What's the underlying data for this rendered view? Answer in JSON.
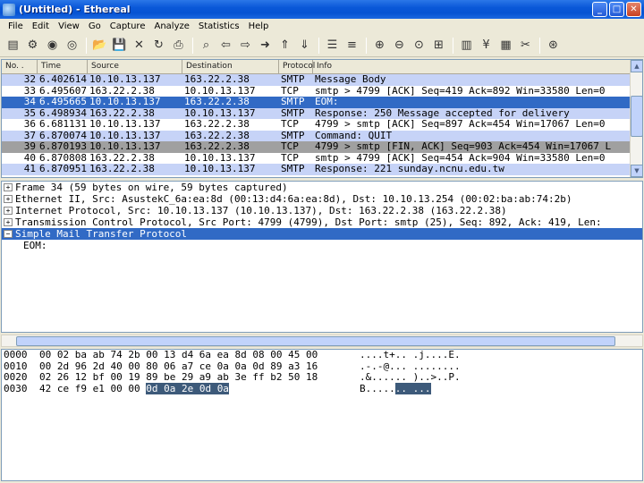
{
  "window": {
    "title": "(Untitled) - Ethereal",
    "minimize": "_",
    "maximize": "□",
    "close": "✕"
  },
  "menu": [
    "File",
    "Edit",
    "View",
    "Go",
    "Capture",
    "Analyze",
    "Statistics",
    "Help"
  ],
  "toolbar_icons": [
    "interface-list-icon",
    "capture-options-icon",
    "start-capture-icon",
    "restart-capture-icon",
    "|",
    "open-file-icon",
    "save-icon",
    "close-file-icon",
    "reload-icon",
    "print-icon",
    "|",
    "find-packet-icon",
    "go-back-icon",
    "go-forward-icon",
    "go-to-packet-icon",
    "go-first-icon",
    "go-last-icon",
    "|",
    "colorize-icon",
    "auto-scroll-icon",
    "|",
    "zoom-in-icon",
    "zoom-out-icon",
    "zoom-normal-icon",
    "resize-columns-icon",
    "|",
    "capture-filters-icon",
    "display-filters-icon",
    "coloring-rules-icon",
    "preferences-icon",
    "|",
    "help-icon"
  ],
  "packet_list": {
    "columns": [
      "No. .",
      "Time",
      "Source",
      "Destination",
      "Protocol",
      "Info"
    ],
    "rows": [
      {
        "no": "32",
        "time": "6.402614",
        "src": "10.10.13.137",
        "dst": "163.22.2.38",
        "proto": "SMTP",
        "info": "Message Body",
        "bg": "#c6d3f7",
        "fg": "#000000"
      },
      {
        "no": "33",
        "time": "6.495607",
        "src": "163.22.2.38",
        "dst": "10.10.13.137",
        "proto": "TCP",
        "info": "smtp > 4799 [ACK] Seq=419 Ack=892 Win=33580 Len=0",
        "bg": "#ffffff",
        "fg": "#000000"
      },
      {
        "no": "34",
        "time": "6.495665",
        "src": "10.10.13.137",
        "dst": "163.22.2.38",
        "proto": "SMTP",
        "info": "EOM:",
        "bg": "#316ac5",
        "fg": "#ffffff"
      },
      {
        "no": "35",
        "time": "6.498934",
        "src": "163.22.2.38",
        "dst": "10.10.13.137",
        "proto": "SMTP",
        "info": "Response: 250 Message accepted for delivery",
        "bg": "#c6d3f7",
        "fg": "#000000"
      },
      {
        "no": "36",
        "time": "6.681131",
        "src": "10.10.13.137",
        "dst": "163.22.2.38",
        "proto": "TCP",
        "info": "4799 > smtp [ACK] Seq=897 Ack=454 Win=17067 Len=0",
        "bg": "#ffffff",
        "fg": "#000000"
      },
      {
        "no": "37",
        "time": "6.870074",
        "src": "10.10.13.137",
        "dst": "163.22.2.38",
        "proto": "SMTP",
        "info": "Command: QUIT",
        "bg": "#c6d3f7",
        "fg": "#000000"
      },
      {
        "no": "39",
        "time": "6.870193",
        "src": "10.10.13.137",
        "dst": "163.22.2.38",
        "proto": "TCP",
        "info": "4799 > smtp [FIN, ACK] Seq=903 Ack=454 Win=17067 L",
        "bg": "#a0a0a0",
        "fg": "#000000"
      },
      {
        "no": "40",
        "time": "6.870808",
        "src": "163.22.2.38",
        "dst": "10.10.13.137",
        "proto": "TCP",
        "info": "smtp > 4799 [ACK] Seq=454 Ack=904 Win=33580 Len=0",
        "bg": "#ffffff",
        "fg": "#000000"
      },
      {
        "no": "41",
        "time": "6.870951",
        "src": "163.22.2.38",
        "dst": "10.10.13.137",
        "proto": "SMTP",
        "info": "Response: 221 sunday.ncnu.edu.tw",
        "bg": "#c6d3f7",
        "fg": "#000000"
      }
    ]
  },
  "details": [
    {
      "exp": "+",
      "text": "Frame 34 (59 bytes on wire, 59 bytes captured)",
      "selected": false
    },
    {
      "exp": "+",
      "text": "Ethernet II, Src: AsustekC_6a:ea:8d (00:13:d4:6a:ea:8d), Dst: 10.10.13.254 (00:02:ba:ab:74:2b)",
      "selected": false
    },
    {
      "exp": "+",
      "text": "Internet Protocol, Src: 10.10.13.137 (10.10.13.137), Dst: 163.22.2.38 (163.22.2.38)",
      "selected": false
    },
    {
      "exp": "+",
      "text": "Transmission Control Protocol, Src Port: 4799 (4799), Dst Port: smtp (25), Seq: 892, Ack: 419, Len:",
      "selected": false
    },
    {
      "exp": "−",
      "text": "Simple Mail Transfer Protocol",
      "selected": true
    },
    {
      "exp": "",
      "text": "EOM:",
      "selected": false
    }
  ],
  "hex": [
    {
      "off": "0000",
      "bytes": "00 02 ba ab 74 2b 00 13  d4 6a ea 8d 08 00 45 00",
      "ascii": "....t+.. .j....E."
    },
    {
      "off": "0010",
      "bytes": "00 2d 96 2d 40 00 80 06  a7 ce 0a 0a 0d 89 a3 16",
      "ascii": ".-.-@... ........"
    },
    {
      "off": "0020",
      "bytes": "02 26 12 bf 00 19 89 be  29 a9 ab 3e ff b2 50 18",
      "ascii": ".&...... )..>..P."
    },
    {
      "off": "0030",
      "bytes_plain": "42 ce f9 e1 00 00 ",
      "bytes_hl": "0d 0a  2e 0d 0a",
      "ascii_plain": "B.....",
      "ascii_hl": ".. ..."
    }
  ]
}
